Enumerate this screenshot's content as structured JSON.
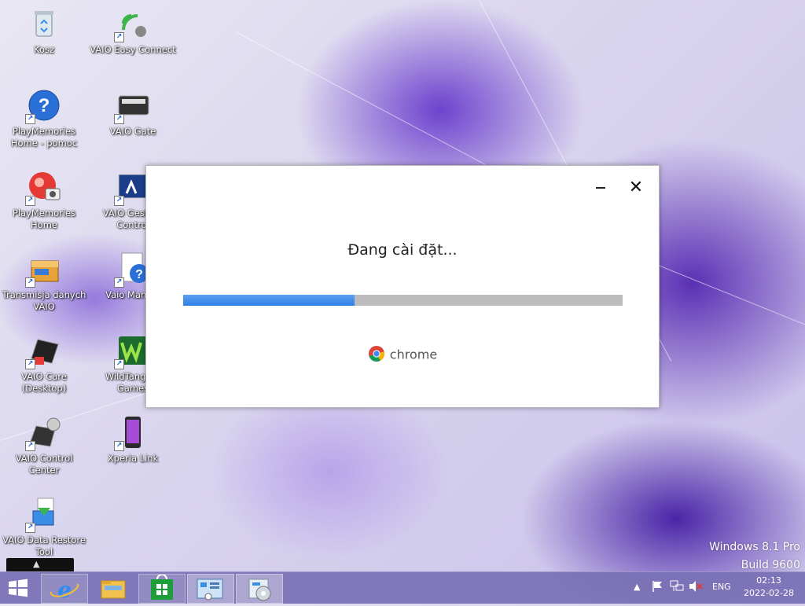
{
  "desktop": {
    "icons": [
      {
        "label": "Kosz"
      },
      {
        "label": "VAIO Easy Connect"
      },
      {
        "label": "PlayMemories Home - pomoc"
      },
      {
        "label": "VAIO Gate"
      },
      {
        "label": "PlayMemories Home"
      },
      {
        "label": "VAIO Gesture Control"
      },
      {
        "label": "Transmisja danych VAIO"
      },
      {
        "label": "Vaio Manual"
      },
      {
        "label": "VAIO Care (Desktop)"
      },
      {
        "label": "WildTangent Games"
      },
      {
        "label": "VAIO Control Center"
      },
      {
        "label": "Xperia Link"
      },
      {
        "label": "VAIO Data Restore Tool"
      }
    ]
  },
  "installer": {
    "status_text": "Đang cài đặt...",
    "progress_fraction": 0.39,
    "brand": "chrome",
    "accent_color": "#2f7fe4",
    "minimize_glyph": "—",
    "close_glyph": "✕"
  },
  "watermark": {
    "line1": "Windows 8.1 Pro",
    "line2": "Build 9600"
  },
  "taskbar": {
    "start_icon": "windows-logo-icon",
    "apps": [
      "internet-explorer-icon",
      "file-explorer-icon",
      "store-icon",
      "control-panel-icon",
      "installer-app-icon"
    ],
    "tray": {
      "language": "ENG",
      "time": "02:13",
      "date": "2022-02-28",
      "icons": [
        "show-hidden-icons-icon",
        "action-center-flag-icon",
        "network-icon",
        "volume-muted-icon"
      ]
    },
    "colors": {
      "taskbar_bg": "#7870b4"
    }
  }
}
